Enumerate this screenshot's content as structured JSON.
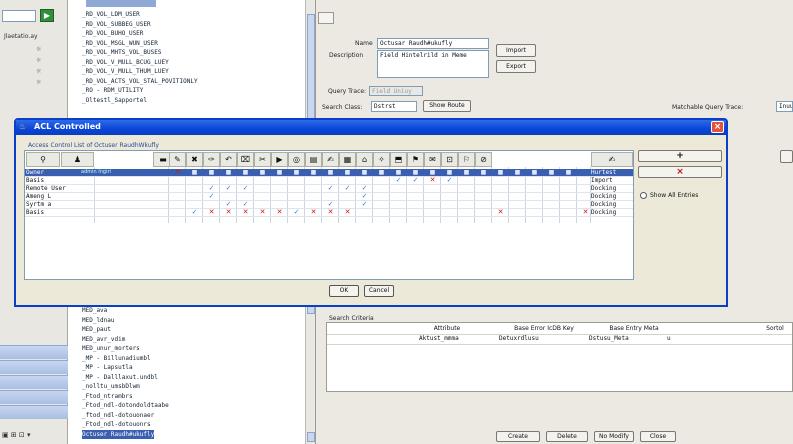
{
  "left_strip": {
    "label": "Jlaetatio.ay",
    "stars": [
      "☼",
      "☼",
      "☼",
      "☼"
    ],
    "bottom_tools": "▣ ⊞ ⊡ ▾"
  },
  "tree": {
    "nodes": [
      "_RD_VOL_LDM_USER",
      "_RD_VOL_SUBBEG_USER",
      "_RD_VOL_BUHO_USER",
      "_RD_VOL_MSGL_WUN_USER",
      "_RD_VOL_MHTS_VOL_BUSES",
      "_RD_VOL_V_MULL_BCUG_LUEY",
      "_RD_VOL_V_MULL_THUM_LUEY",
      "_RD_VOL_ACTS_VOL_STAL_POVITIONLY",
      "_RO - RDM_UTILITY",
      "_Oltestl_Sapportel",
      "MED_ava",
      "MED_ldnau",
      "MED_paut",
      "MED_avr_vdim",
      "MED_unur_morters",
      "_MP - Billunadiumbl",
      "_MP - Lapsutla",
      "_MP - Dalllaxut.undbl",
      "_nolltu_umsbDlwm",
      "_Ftod_ntrambrs",
      "_Ftod_ndl-dotondoldtaabe",
      "_ftod_ndl-dotouonaer",
      "_Ftod_ndl-dotouonrs",
      "Octuser Raudh#ukufly"
    ]
  },
  "details": {
    "name_label": "Name",
    "name_value": "Octusar Raudh#ukufly",
    "description_label": "Description",
    "description_value": "Field Hintelrild in Meme",
    "import_label": "Import",
    "export_label": "Export",
    "query_trace_label": "Query Trace:",
    "query_trace_value": "Field Uniuy",
    "search_class_label": "Search Class:",
    "search_class_value": "Dstrst",
    "show_route_label": "Show Route",
    "matchable_label": "Matchable Query Trace:",
    "matchable_value": "Inuu"
  },
  "criteria": {
    "caption": "Search Criteria",
    "headers": [
      "Attribute",
      "Base Error IcDB Key",
      "Base Entry Meta",
      "Sortol"
    ],
    "row": [
      "Aktust_mmma",
      "Detuxrdlusu",
      "Dstusu_Meta",
      "u"
    ]
  },
  "bottom_bar": {
    "create_label": "Create",
    "delete_label": "Delete",
    "modify_label": "No Modify",
    "close_label": "Close"
  },
  "acl_dialog": {
    "title": "ACL Controlled",
    "caption": "Access Control List of Octuser RaudhWkufly",
    "header_icons": [
      "⚲",
      "♟",
      "▬",
      "✎",
      "✖",
      "✑",
      "↶",
      "⌧",
      "✂",
      "▶",
      "◎",
      "▤",
      "✍",
      "▦",
      "⌂",
      "✧",
      "⬒",
      "⚑",
      "✉",
      "⊡",
      "⚐",
      "⊘",
      "✍"
    ],
    "rows": [
      {
        "label": "Owner",
        "detail": "admin Ingiri",
        "status": "Hurtest"
      },
      {
        "label": "Basis",
        "detail": "",
        "status": "Import"
      },
      {
        "label": "Remote User",
        "detail": "",
        "status": "Docking"
      },
      {
        "label": "Ameng L",
        "detail": "",
        "status": "Docking"
      },
      {
        "label": "Syrtm a",
        "detail": "",
        "status": "Docking"
      },
      {
        "label": "Basis",
        "detail": "",
        "status": "Docking"
      }
    ],
    "add_btn": "+",
    "remove_btn": "×",
    "show_all_label": "Show All Entries",
    "ok_label": "OK",
    "cancel_label": "Cancel"
  },
  "colors": {
    "title_bar": "#0a46d8",
    "check": "#2a7fd8",
    "cross": "#d01818",
    "selection": "#3a5fb0"
  }
}
